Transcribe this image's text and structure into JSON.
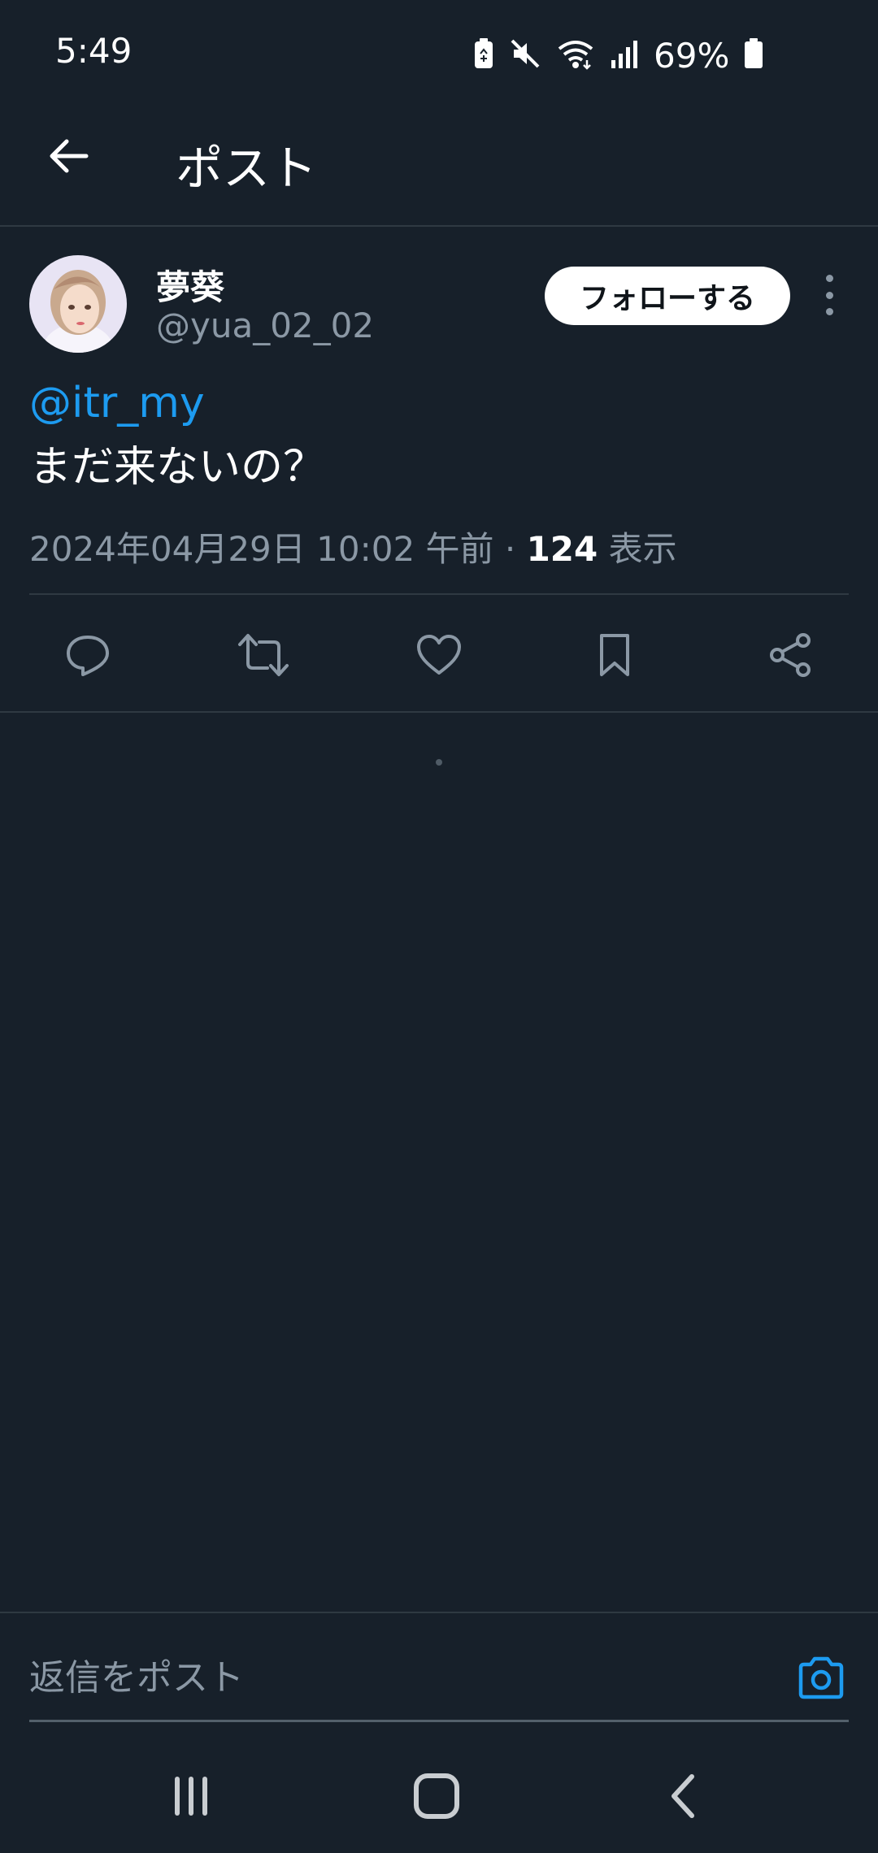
{
  "status_bar": {
    "time": "5:49",
    "battery_percent": "69%",
    "icons": [
      "battery-saver-icon",
      "mute-icon",
      "wifi-icon",
      "signal-icon",
      "battery-icon"
    ]
  },
  "header": {
    "back_icon": "arrow-left-icon",
    "title": "ポスト"
  },
  "post": {
    "author": {
      "display_name": "夢葵",
      "handle": "@yua_02_02"
    },
    "follow_label": "フォローする",
    "more_icon": "more-vertical-icon",
    "mention": "@itr_my",
    "text": "まだ来ないの？",
    "meta": {
      "datetime": "2024年04月29日 10:02 午前 · ",
      "views_count": "124",
      "views_label": " 表示"
    },
    "actions": [
      "reply-icon",
      "repost-icon",
      "like-icon",
      "bookmark-icon",
      "share-icon"
    ]
  },
  "reply_bar": {
    "placeholder": "返信をポスト",
    "camera_icon": "camera-icon"
  },
  "nav_bar": {
    "icons": [
      "recent-apps-icon",
      "home-icon",
      "back-icon"
    ]
  },
  "colors": {
    "background": "#17202a",
    "accent": "#1d9bf0",
    "secondary_text": "#8b98a5",
    "divider": "#2f3942"
  }
}
